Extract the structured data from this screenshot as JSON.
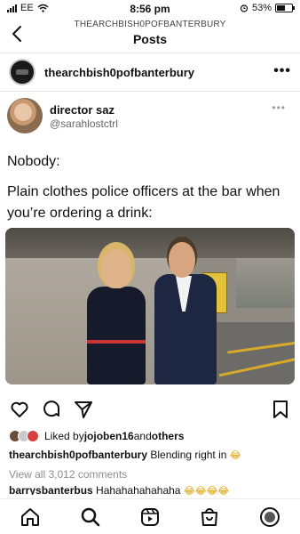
{
  "status_bar": {
    "carrier": "EE",
    "time": "8:56 pm",
    "battery": "53%"
  },
  "header": {
    "subtitle": "THEARCHBISH0POFBANTERBURY",
    "title": "Posts"
  },
  "post": {
    "username": "thearchbish0pofbanterbury",
    "more": "•••"
  },
  "tweet": {
    "display_name": "director saz",
    "handle": "@sarahlostctrl",
    "more": "•••",
    "line1": "Nobody:",
    "line2": "Plain clothes police officers at the bar when you’re ordering a drink:"
  },
  "engagement": {
    "liked_prefix": "Liked by ",
    "liked_user": "jojoben16",
    "liked_and": " and ",
    "liked_others": "others",
    "caption_user": "thearchbish0pofbanterbury",
    "caption_text": " Blending right in",
    "caption_emoji": "😂",
    "view_comments": "View all 3,012 comments",
    "comment_user": "barrysbanterbus",
    "comment_text": " Hahahahahahaha",
    "comment_emoji": "😂😂😂😂"
  },
  "colors": {
    "accent_text": "#111111",
    "muted_text": "#8e8e8e"
  },
  "icons": {
    "actions": [
      "heart-icon",
      "comment-icon",
      "share-icon",
      "bookmark-icon"
    ],
    "nav": [
      "home-icon",
      "search-icon",
      "reels-icon",
      "shop-icon",
      "profile-icon"
    ]
  }
}
